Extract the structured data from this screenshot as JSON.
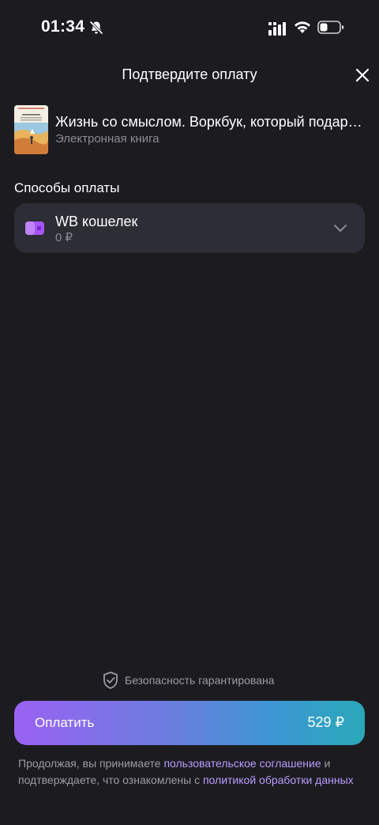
{
  "status_bar": {
    "time": "01:34",
    "icons": [
      "bell-slash-icon",
      "signal-icon",
      "wifi-icon",
      "battery-icon"
    ]
  },
  "header": {
    "title": "Подтвердите оплату",
    "close_icon": "close-icon"
  },
  "product": {
    "title": "Жизнь со смыслом. Воркбук, который подарит вам новые смыслы",
    "subtitle": "Электронная книга"
  },
  "payment": {
    "section_title": "Способы оплаты",
    "method": {
      "name": "WB кошелек",
      "balance": "0 ₽",
      "icon": "wallet-icon"
    }
  },
  "footer": {
    "security_text": "Безопасность гарантирована",
    "pay_label": "Оплатить",
    "pay_amount": "529 ₽",
    "legal": {
      "part1": "Продолжая, вы принимаете ",
      "link1": "пользовательское соглашение",
      "part2": " и подтверждаете, что ознакомлены с ",
      "link2": "политикой обработки данных"
    }
  },
  "colors": {
    "background": "#1c1c20",
    "card": "#2d2d35",
    "muted_text": "#8b8b93",
    "link": "#b99cff",
    "wallet": "#a855f7",
    "gradient_start": "#9a62f3",
    "gradient_end": "#2aa8b8"
  }
}
